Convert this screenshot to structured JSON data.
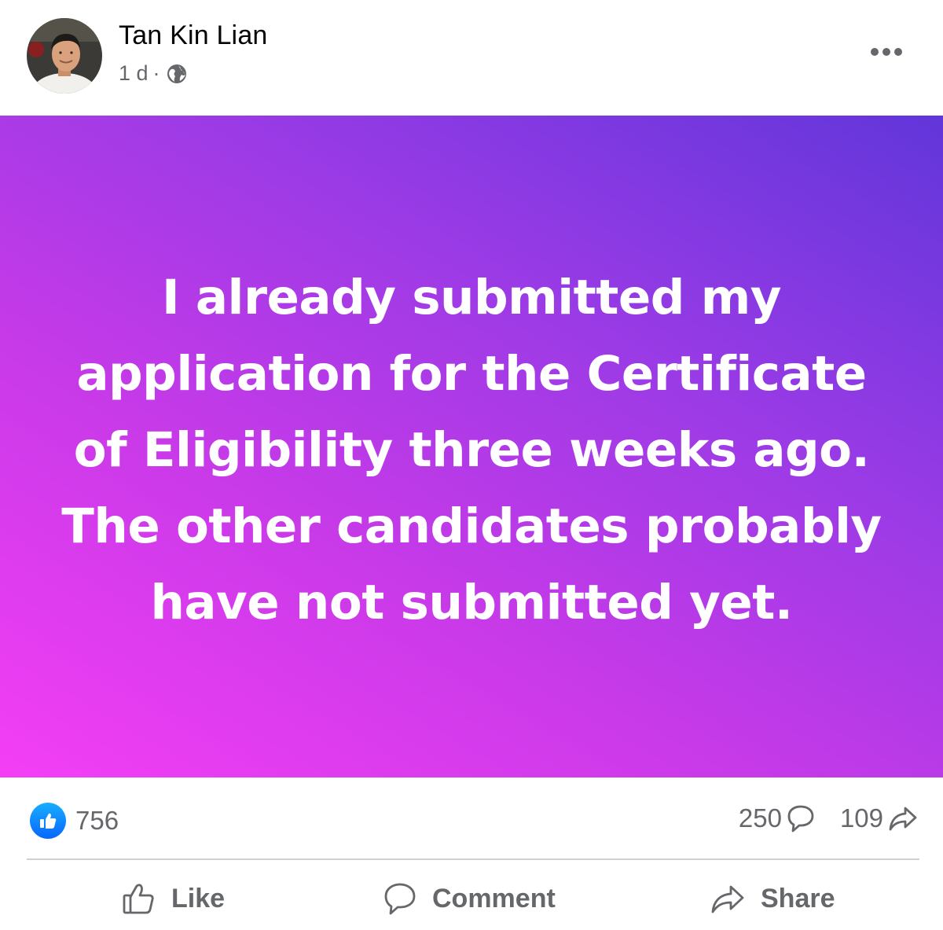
{
  "post": {
    "author": "Tan Kin Lian",
    "time": "1 d",
    "separator": "·",
    "audience_icon": "globe-icon",
    "more_icon": "more-options-icon",
    "background_gradient": [
      "#f43ef5",
      "#9b3be6",
      "#6136da"
    ],
    "text": "I already submitted my application for the Certificate of Eligibility three weeks ago. The other candidates probably have not submitted yet."
  },
  "stats": {
    "reaction_icon": "like-reaction-icon",
    "reactions": "756",
    "comments": "250",
    "comments_icon": "comment-bubble-icon",
    "shares": "109",
    "shares_icon": "share-arrow-icon"
  },
  "actions": {
    "like_label": "Like",
    "comment_label": "Comment",
    "share_label": "Share"
  },
  "colors": {
    "text_primary": "#050505",
    "text_secondary": "#65676b",
    "like_blue": "#0866ff",
    "divider": "#ced0d4"
  }
}
